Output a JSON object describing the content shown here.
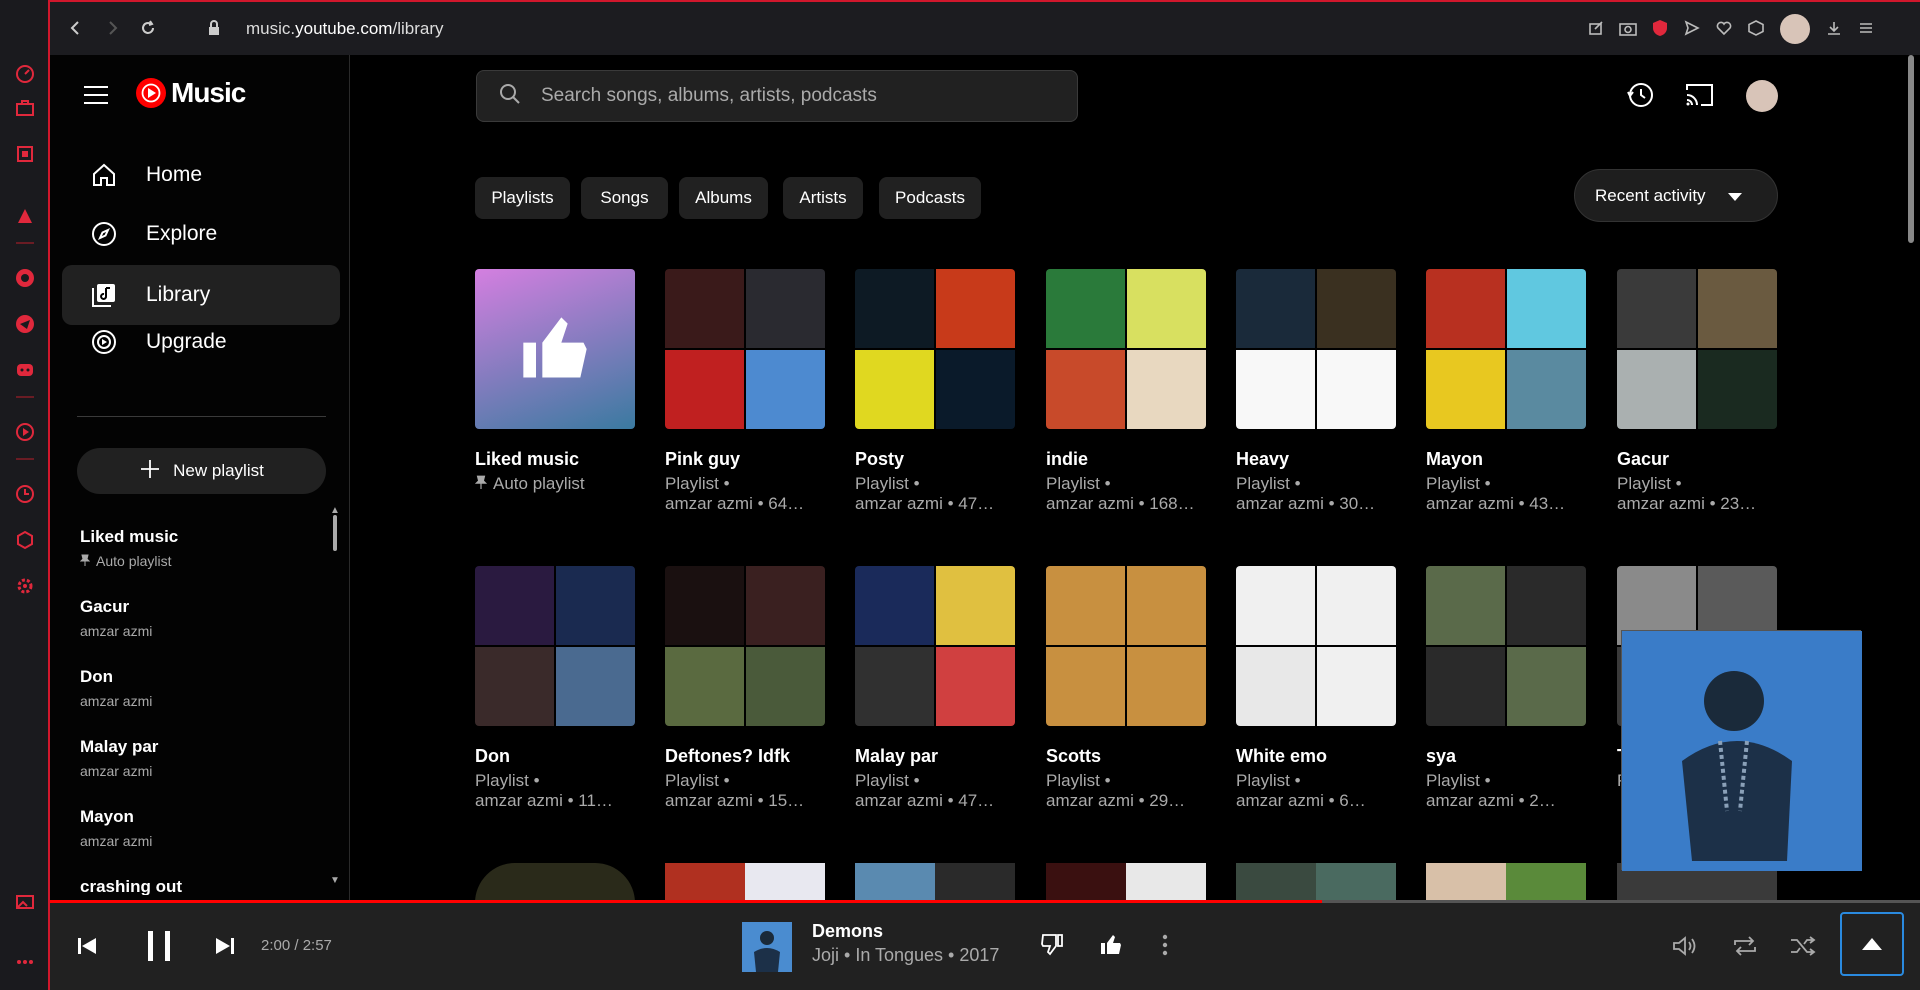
{
  "browser": {
    "url_prefix": "music.",
    "url_host": "youtube.com",
    "url_path": "/library"
  },
  "app": {
    "logo_text": "Music"
  },
  "sidebar": {
    "nav": [
      {
        "label": "Home",
        "icon": "home-icon"
      },
      {
        "label": "Explore",
        "icon": "compass-icon"
      },
      {
        "label": "Library",
        "icon": "library-icon",
        "active": true
      },
      {
        "label": "Upgrade",
        "icon": "upgrade-icon"
      }
    ],
    "new_playlist": "New playlist",
    "library": [
      {
        "title": "Liked music",
        "subtitle": "Auto playlist",
        "pinned": true
      },
      {
        "title": "Gacur",
        "subtitle": "amzar azmi"
      },
      {
        "title": "Don",
        "subtitle": "amzar azmi"
      },
      {
        "title": "Malay par",
        "subtitle": "amzar azmi"
      },
      {
        "title": "Mayon",
        "subtitle": "amzar azmi"
      },
      {
        "title": "crashing out",
        "subtitle": ""
      }
    ]
  },
  "search": {
    "placeholder": "Search songs, albums, artists, podcasts"
  },
  "filters": [
    "Playlists",
    "Songs",
    "Albums",
    "Artists",
    "Podcasts"
  ],
  "sort": {
    "label": "Recent activity"
  },
  "row1": [
    {
      "title": "Liked music",
      "line1": "Auto playlist",
      "line2": "",
      "pinned": true,
      "colors": [
        "#d47fe0",
        "#3a7aa0"
      ]
    },
    {
      "title": "Pink guy",
      "line1": "Playlist •",
      "line2": "amzar azmi • 64…",
      "colors": [
        "#3a1a1a",
        "#2a2a30",
        "#c02020",
        "#4d8ad0"
      ]
    },
    {
      "title": "Posty",
      "line1": "Playlist •",
      "line2": "amzar azmi • 47…",
      "colors": [
        "#0d1a24",
        "#c83a1a",
        "#e0d820",
        "#0a1a2a"
      ]
    },
    {
      "title": "indie",
      "line1": "Playlist •",
      "line2": "amzar azmi • 168…",
      "colors": [
        "#2a7a3a",
        "#d8e060",
        "#c84a2a",
        "#e8d8c0"
      ]
    },
    {
      "title": "Heavy",
      "line1": "Playlist •",
      "line2": "amzar azmi • 30…",
      "colors": [
        "#1a2a3a",
        "#3a3020",
        "#f8f8f8",
        "#f8f8f8"
      ]
    },
    {
      "title": "Mayon",
      "line1": "Playlist •",
      "line2": "amzar azmi • 43…",
      "colors": [
        "#b83020",
        "#60c8e0",
        "#e8c820",
        "#5a8aa0"
      ]
    },
    {
      "title": "Gacur",
      "line1": "Playlist •",
      "line2": "amzar azmi • 23…",
      "colors": [
        "#3a3a3a",
        "#6a5a40",
        "#aab0b0",
        "#1a2a20"
      ]
    }
  ],
  "row2": [
    {
      "title": "Don",
      "line1": "Playlist •",
      "line2": "amzar azmi • 11…",
      "colors": [
        "#2a1a40",
        "#1a2a50",
        "#3a2a2a",
        "#4a6a90"
      ]
    },
    {
      "title": "Deftones? Idfk",
      "line1": "Playlist •",
      "line2": "amzar azmi • 15…",
      "colors": [
        "#1a1010",
        "#3a2020",
        "#5a6a40",
        "#4a5a3a"
      ]
    },
    {
      "title": "Malay par",
      "line1": "Playlist •",
      "line2": "amzar azmi • 47…",
      "colors": [
        "#1a2a5a",
        "#e0c040",
        "#303030",
        "#d04040"
      ]
    },
    {
      "title": "Scotts",
      "line1": "Playlist •",
      "line2": "amzar azmi • 29…",
      "colors": [
        "#c89040",
        "#c89040",
        "#c89040",
        "#c89040"
      ]
    },
    {
      "title": "White emo",
      "line1": "Playlist •",
      "line2": "amzar azmi • 6…",
      "colors": [
        "#f0f0f0",
        "#f0f0f0",
        "#e8e8e8",
        "#f0f0f0"
      ]
    },
    {
      "title": "sya",
      "line1": "Playlist •",
      "line2": "amzar azmi • 2…",
      "colors": [
        "#5a6a4a",
        "#2a2a2a",
        "#2a2a2a",
        "#5a6a4a"
      ]
    },
    {
      "title": "T",
      "line1": "P",
      "line2": "",
      "colors": [
        "#8a8a8a",
        "#5a5a5a",
        "#3a3a3a",
        "#2a2a2a"
      ]
    }
  ],
  "player": {
    "time": "2:00 / 2:57",
    "progress": 0.68,
    "title": "Demons",
    "meta": "Joji • In Tongues • 2017"
  }
}
